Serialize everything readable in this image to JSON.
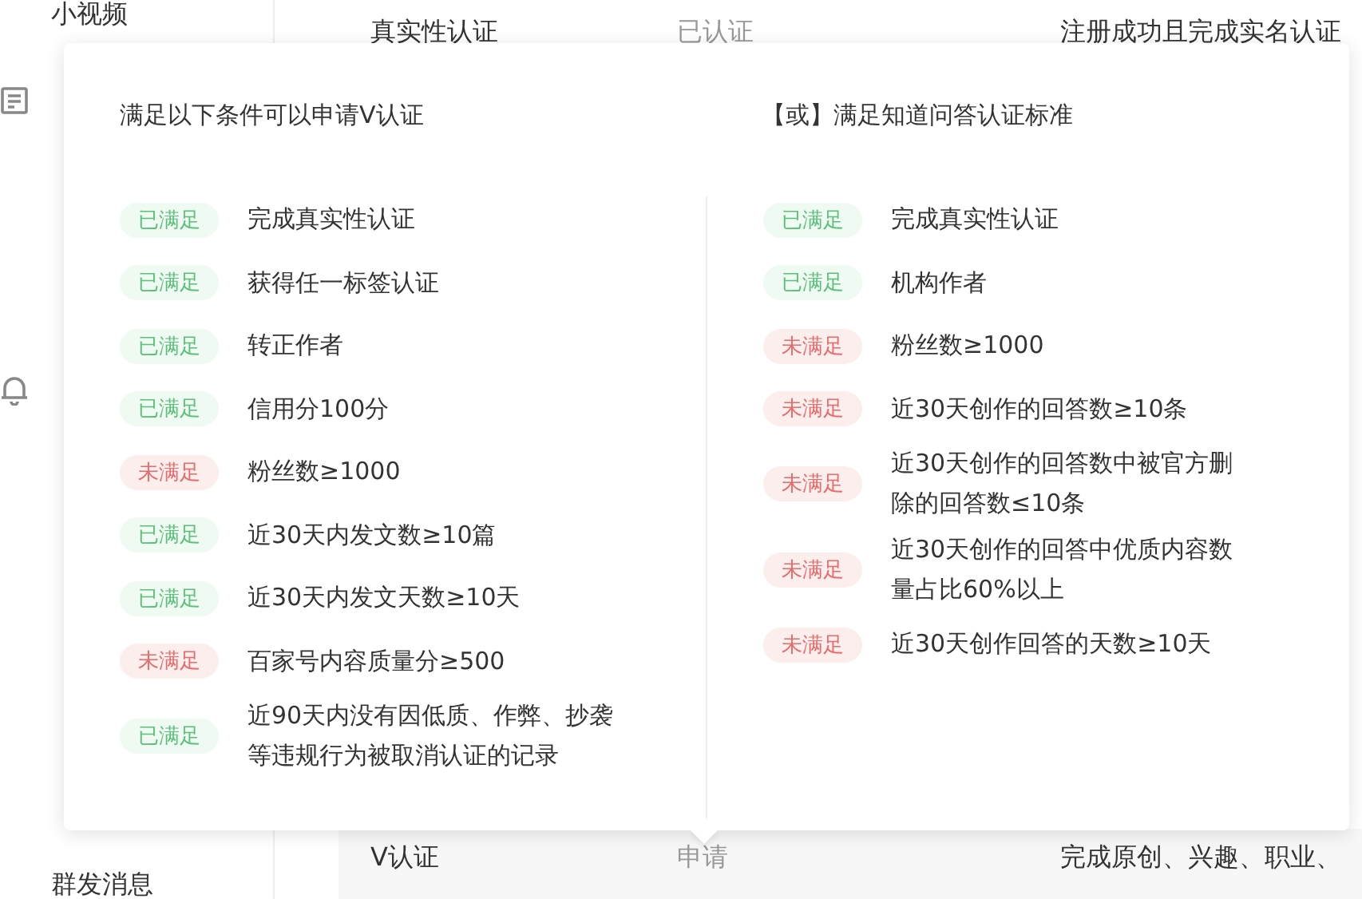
{
  "sidebar": {
    "items": [
      {
        "label": "小视频"
      },
      {
        "label": "群发消息"
      }
    ]
  },
  "table": {
    "rows": [
      {
        "name": "真实性认证",
        "status": "已认证",
        "description": "注册成功且完成实名认证"
      },
      {
        "name": "V认证",
        "status": "申请",
        "description": "完成原创、兴趣、职业、"
      }
    ]
  },
  "popover": {
    "columns": [
      {
        "title": "满足以下条件可以申请V认证",
        "conditions": [
          {
            "badge": "已满足",
            "met": true,
            "text": "完成真实性认证"
          },
          {
            "badge": "已满足",
            "met": true,
            "text": "获得任一标签认证"
          },
          {
            "badge": "已满足",
            "met": true,
            "text": "转正作者"
          },
          {
            "badge": "已满足",
            "met": true,
            "text": "信用分100分"
          },
          {
            "badge": "未满足",
            "met": false,
            "text": "粉丝数≥1000"
          },
          {
            "badge": "已满足",
            "met": true,
            "text": "近30天内发文数≥10篇"
          },
          {
            "badge": "已满足",
            "met": true,
            "text": "近30天内发文天数≥10天"
          },
          {
            "badge": "未满足",
            "met": false,
            "text": "百家号内容质量分≥500"
          },
          {
            "badge": "已满足",
            "met": true,
            "text": "近90天内没有因低质、作弊、抄袭等违规行为被取消认证的记录"
          }
        ]
      },
      {
        "title": "【或】满足知道问答认证标准",
        "conditions": [
          {
            "badge": "已满足",
            "met": true,
            "text": "完成真实性认证"
          },
          {
            "badge": "已满足",
            "met": true,
            "text": "机构作者"
          },
          {
            "badge": "未满足",
            "met": false,
            "text": "粉丝数≥1000"
          },
          {
            "badge": "未满足",
            "met": false,
            "text": "近30天创作的回答数≥10条"
          },
          {
            "badge": "未满足",
            "met": false,
            "text": "近30天创作的回答数中被官方删除的回答数≤10条"
          },
          {
            "badge": "未满足",
            "met": false,
            "text": "近30天创作的回答中优质内容数量占比60%以上"
          },
          {
            "badge": "未满足",
            "met": false,
            "text": "近30天创作回答的天数≥10天"
          }
        ]
      }
    ]
  }
}
